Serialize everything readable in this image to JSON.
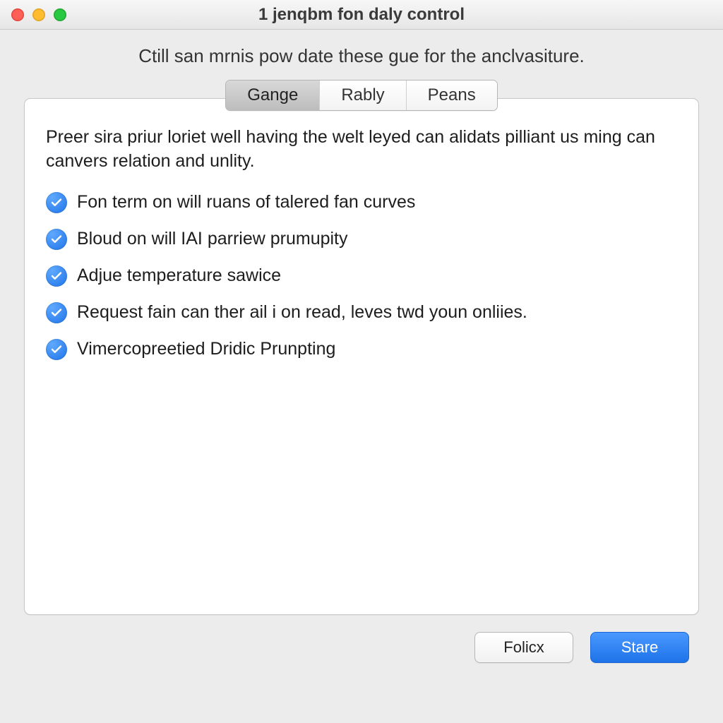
{
  "window": {
    "title": "1 jenqbm fon daly control"
  },
  "subtitle": "Ctill san mrnis pow date these gue for the anclvasiture.",
  "tabs": {
    "items": [
      {
        "label": "Gange",
        "active": true
      },
      {
        "label": "Rably",
        "active": false
      },
      {
        "label": "Peans",
        "active": false
      }
    ]
  },
  "panel": {
    "intro": "Preer sira priur loriet well having the welt leyed can alidats pilliant us ming can canvers relation and unlity.",
    "checks": [
      {
        "label": "Fon term on will ruans of talered fan curves",
        "checked": true
      },
      {
        "label": "Bloud on will IAI parriew prumupity",
        "checked": true
      },
      {
        "label": "Adjue temperature sawice",
        "checked": true
      },
      {
        "label": "Request fain can ther ail i on read, leves twd youn onliies.",
        "checked": true
      },
      {
        "label": "Vimercopreetied Dridic Prunpting",
        "checked": true
      }
    ]
  },
  "footer": {
    "secondary": "Folicx",
    "primary": "Stare"
  }
}
